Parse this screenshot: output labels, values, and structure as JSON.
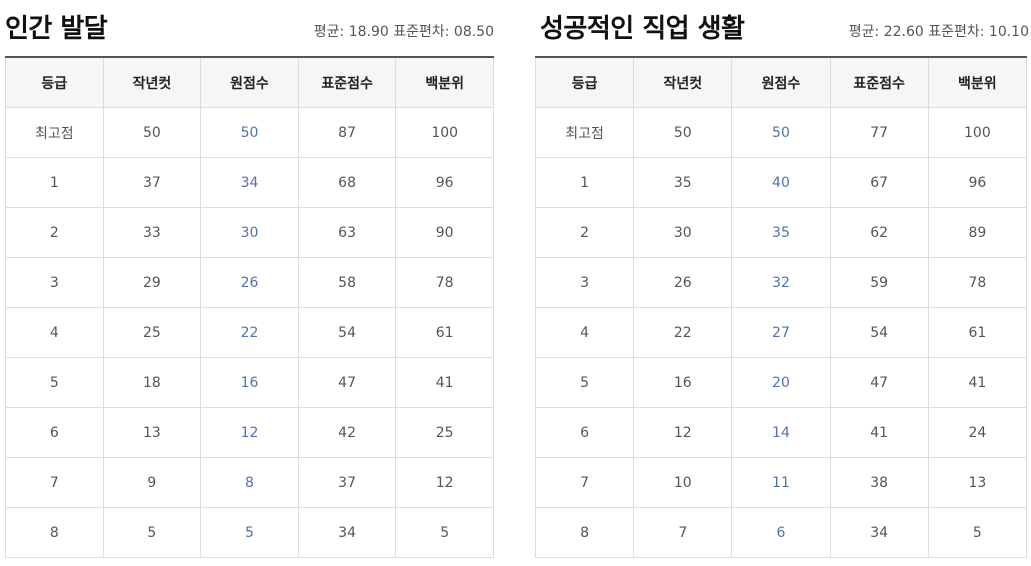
{
  "colors": {
    "raw_score": "#4f72b2",
    "header_bg": "#f6f6f6"
  },
  "tables": [
    {
      "title": "인간 발달",
      "stats": "평균: 18.90 표준편차: 08.50",
      "columns": [
        "등급",
        "작년컷",
        "원점수",
        "표준점수",
        "백분위"
      ],
      "rows": [
        [
          "최고점",
          "50",
          "50",
          "87",
          "100"
        ],
        [
          "1",
          "37",
          "34",
          "68",
          "96"
        ],
        [
          "2",
          "33",
          "30",
          "63",
          "90"
        ],
        [
          "3",
          "29",
          "26",
          "58",
          "78"
        ],
        [
          "4",
          "25",
          "22",
          "54",
          "61"
        ],
        [
          "5",
          "18",
          "16",
          "47",
          "41"
        ],
        [
          "6",
          "13",
          "12",
          "42",
          "25"
        ],
        [
          "7",
          "9",
          "8",
          "37",
          "12"
        ],
        [
          "8",
          "5",
          "5",
          "34",
          "5"
        ]
      ]
    },
    {
      "title": "성공적인 직업 생활",
      "stats": "평균: 22.60 표준편차: 10.10",
      "columns": [
        "등급",
        "작년컷",
        "원점수",
        "표준점수",
        "백분위"
      ],
      "rows": [
        [
          "최고점",
          "50",
          "50",
          "77",
          "100"
        ],
        [
          "1",
          "35",
          "40",
          "67",
          "96"
        ],
        [
          "2",
          "30",
          "35",
          "62",
          "89"
        ],
        [
          "3",
          "26",
          "32",
          "59",
          "78"
        ],
        [
          "4",
          "22",
          "27",
          "54",
          "61"
        ],
        [
          "5",
          "16",
          "20",
          "47",
          "41"
        ],
        [
          "6",
          "12",
          "14",
          "41",
          "24"
        ],
        [
          "7",
          "10",
          "11",
          "38",
          "13"
        ],
        [
          "8",
          "7",
          "6",
          "34",
          "5"
        ]
      ]
    }
  ]
}
